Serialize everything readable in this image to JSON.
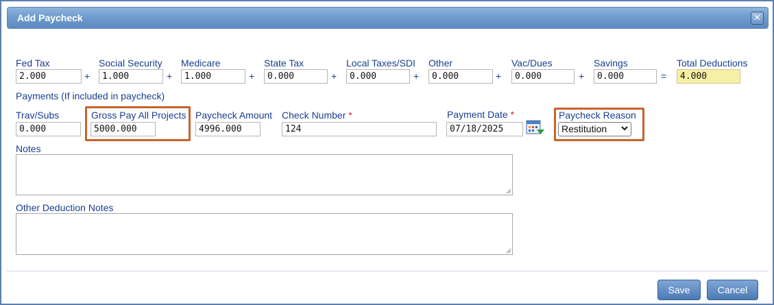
{
  "dialog": {
    "title": "Add Paycheck",
    "close_glyph": "✕"
  },
  "deductions": [
    {
      "label": "Fed Tax",
      "value": "2.000",
      "op": "+"
    },
    {
      "label": "Social Security",
      "value": "1.000",
      "op": "+"
    },
    {
      "label": "Medicare",
      "value": "1.000",
      "op": "+"
    },
    {
      "label": "State Tax",
      "value": "0.000",
      "op": "+"
    },
    {
      "label": "Local Taxes/SDI",
      "value": "0.000",
      "op": "+"
    },
    {
      "label": "Other",
      "value": "0.000",
      "op": "+"
    },
    {
      "label": "Vac/Dues",
      "value": "0.000",
      "op": "+"
    },
    {
      "label": "Savings",
      "value": "0.000",
      "op": "="
    }
  ],
  "total": {
    "label": "Total Deductions",
    "value": "4.000",
    "color": "#f6f0a6"
  },
  "payments": {
    "heading": "Payments (If included in paycheck)",
    "trav_subs": {
      "label": "Trav/Subs",
      "value": "0.000"
    },
    "gross_pay": {
      "label": "Gross Pay All Projects",
      "value": "5000.000"
    },
    "paycheck_amount": {
      "label": "Paycheck Amount",
      "value": "4996.000"
    },
    "check_number": {
      "label": "Check Number",
      "required": "*",
      "value": "124"
    },
    "payment_date": {
      "label": "Payment Date",
      "required": "*",
      "value": "07/18/2025",
      "icon": "calendar-icon"
    },
    "reason": {
      "label": "Paycheck Reason",
      "selected": "Restitution"
    }
  },
  "notes": {
    "label": "Notes",
    "value": ""
  },
  "other_notes": {
    "label": "Other Deduction Notes",
    "value": ""
  },
  "buttons": {
    "save": "Save",
    "cancel": "Cancel"
  },
  "colors": {
    "label": "#1a3d8f",
    "highlight": "#c8612a",
    "title_bar": "#6f9ccd"
  }
}
